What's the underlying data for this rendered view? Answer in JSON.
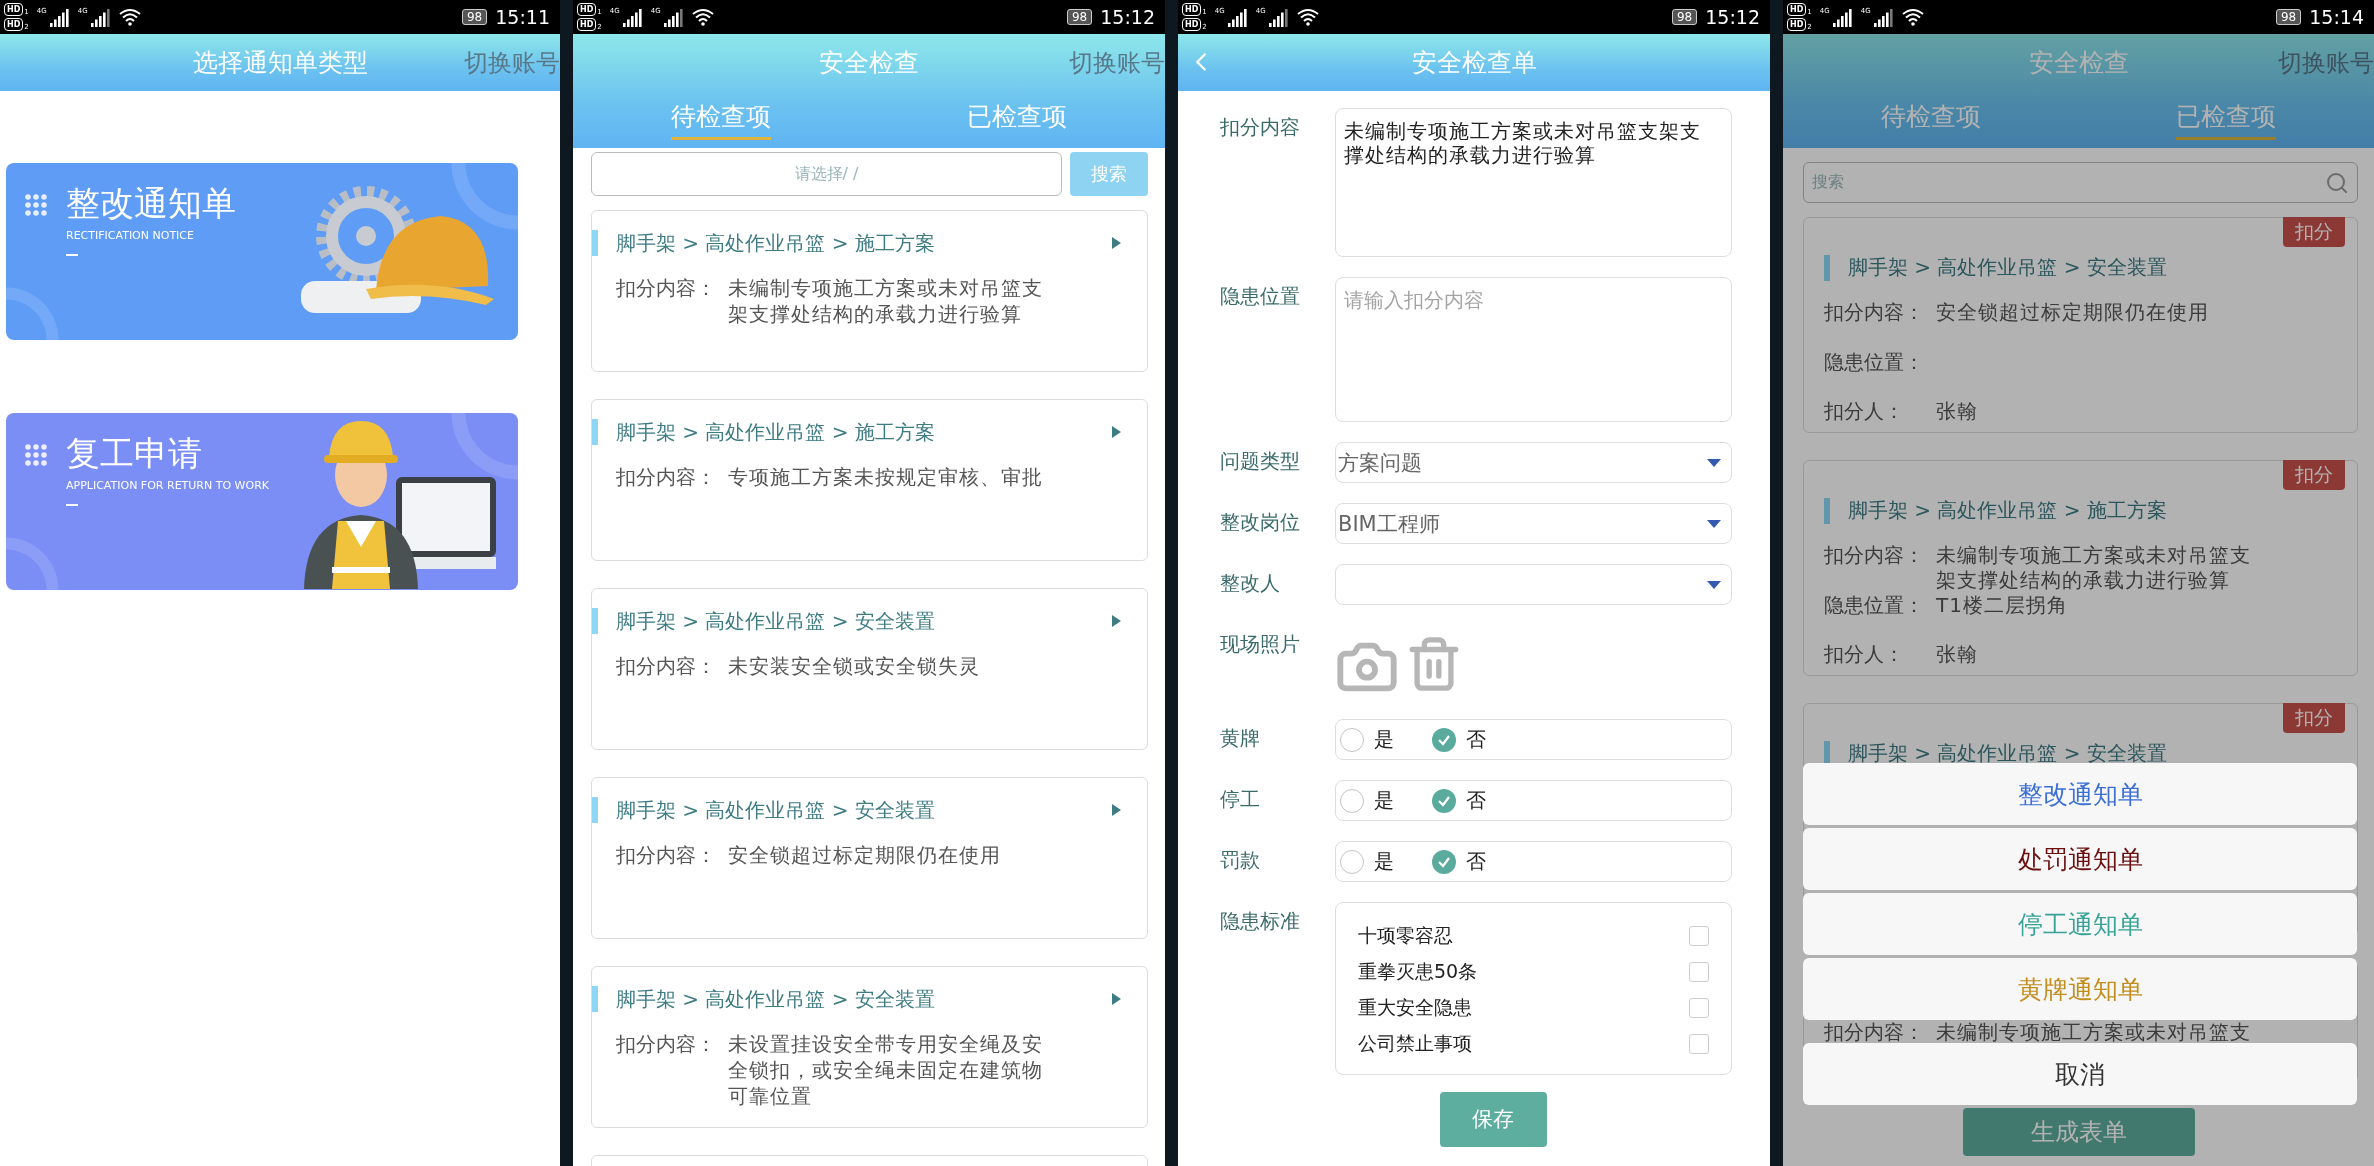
{
  "screens": [
    {
      "kind": "notice_types",
      "status_bar": {
        "sims": [
          {
            "label": "HD",
            "slot": "1"
          },
          {
            "label": "HD",
            "slot": "2"
          }
        ],
        "networks": [
          "4G",
          "4G"
        ],
        "battery": "98",
        "time": "15:11"
      },
      "title": "选择通知单类型",
      "header_action": "切换账号",
      "cards": [
        {
          "kind": "rectification",
          "title": "整改通知单",
          "subtitle": "RECTIFICATION NOTICE"
        },
        {
          "kind": "return_to_work",
          "title": "复工申请",
          "subtitle": "APPLICATION FOR RETURN TO WORK"
        }
      ]
    },
    {
      "kind": "inspection_list",
      "status_bar": {
        "sims": [
          {
            "label": "HD",
            "slot": "1"
          },
          {
            "label": "HD",
            "slot": "2"
          }
        ],
        "networks": [
          "4G",
          "4G"
        ],
        "battery": "98",
        "time": "15:12"
      },
      "title": "安全检查",
      "header_action": "切换账号",
      "tabs": [
        {
          "label": "待检查项",
          "selected": true
        },
        {
          "label": "已检查项",
          "selected": false
        }
      ],
      "search": {
        "placeholder": "请选择/ /",
        "button": "搜索"
      },
      "items": [
        {
          "path": "脚手架 > 高处作业吊篮 > 施工方案",
          "label": "扣分内容：",
          "content": "未编制专项施工方案或未对吊篮支架支撑处结构的承载力进行验算"
        },
        {
          "path": "脚手架 > 高处作业吊篮 > 施工方案",
          "label": "扣分内容：",
          "content": "专项施工方案未按规定审核、审批"
        },
        {
          "path": "脚手架 > 高处作业吊篮 > 安全装置",
          "label": "扣分内容：",
          "content": "未安装安全锁或安全锁失灵"
        },
        {
          "path": "脚手架 > 高处作业吊篮 > 安全装置",
          "label": "扣分内容：",
          "content": "安全锁超过标定期限仍在使用"
        },
        {
          "path": "脚手架 > 高处作业吊篮 > 安全装置",
          "label": "扣分内容：",
          "content": "未设置挂设安全带专用安全绳及安全锁扣，或安全绳未固定在建筑物可靠位置"
        }
      ]
    },
    {
      "kind": "inspection_form",
      "status_bar": {
        "sims": [
          {
            "label": "HD",
            "slot": "1"
          },
          {
            "label": "HD",
            "slot": "2"
          }
        ],
        "networks": [
          "4G",
          "4G"
        ],
        "battery": "98",
        "time": "15:12"
      },
      "title": "安全检查单",
      "fields": [
        {
          "kind": "textarea",
          "label": "扣分内容",
          "value": "未编制专项施工方案或未对吊篮支架支撑处结构的承载力进行验算"
        },
        {
          "kind": "textarea",
          "label": "隐患位置",
          "placeholder": "请输入扣分内容"
        },
        {
          "kind": "select",
          "label": "问题类型",
          "value": "方案问题"
        },
        {
          "kind": "select",
          "label": "整改岗位",
          "value": "BIM工程师"
        },
        {
          "kind": "select",
          "label": "整改人"
        },
        {
          "kind": "photos",
          "label": "现场照片"
        },
        {
          "kind": "radio",
          "label": "黄牌",
          "options": [
            {
              "label": "是",
              "selected": false
            },
            {
              "label": "否",
              "selected": true
            }
          ]
        },
        {
          "kind": "radio",
          "label": "停工",
          "options": [
            {
              "label": "是",
              "selected": false
            },
            {
              "label": "否",
              "selected": true
            }
          ]
        },
        {
          "kind": "radio",
          "label": "罚款",
          "options": [
            {
              "label": "是",
              "selected": false
            },
            {
              "label": "否",
              "selected": true
            }
          ]
        },
        {
          "kind": "checklist",
          "label": "隐患标准",
          "options": [
            {
              "label": "十项零容忍",
              "checked": false
            },
            {
              "label": "重拳灭患50条",
              "checked": false
            },
            {
              "label": "重大安全隐患",
              "checked": false
            },
            {
              "label": "公司禁止事项",
              "checked": false
            }
          ]
        }
      ],
      "save": "保存"
    },
    {
      "kind": "checked_list",
      "status_bar": {
        "sims": [
          {
            "label": "HD",
            "slot": "1"
          },
          {
            "label": "HD",
            "slot": "2"
          }
        ],
        "networks": [
          "4G",
          "4G"
        ],
        "battery": "98",
        "time": "15:14"
      },
      "title": "安全检查",
      "header_action": "切换账号",
      "tabs": [
        {
          "label": "待检查项",
          "selected": false
        },
        {
          "label": "已检查项",
          "selected": true
        }
      ],
      "search": {
        "placeholder": "搜索"
      },
      "items": [
        {
          "badge": "扣分",
          "path": "脚手架 > 高处作业吊篮 > 安全装置",
          "fields": [
            {
              "label": "扣分内容：",
              "value": "安全锁超过标定期限仍在使用"
            },
            {
              "label": "隐患位置："
            },
            {
              "label": "扣分人：",
              "value": "张翰"
            }
          ]
        },
        {
          "badge": "扣分",
          "path": "脚手架 > 高处作业吊篮 > 施工方案",
          "fields": [
            {
              "label": "扣分内容：",
              "value": "未编制专项施工方案或未对吊篮支架支撑处结构的承载力进行验算"
            },
            {
              "label": "隐患位置：",
              "value": "T1楼二层拐角"
            },
            {
              "label": "扣分人：",
              "value": "张翰"
            }
          ]
        },
        {
          "badge": "扣分",
          "path": "脚手架 > 高处作业吊篮 > 安全装置"
        },
        {
          "fields": [
            {
              "label": "扣分内容：",
              "value": "未编制专项施工方案或未对吊篮支"
            }
          ]
        }
      ],
      "generate_button": "生成表单",
      "action_sheet": {
        "options": [
          {
            "label": "整改通知单",
            "color": "#3b6fd6"
          },
          {
            "label": "处罚通知单",
            "color": "#6b1010"
          },
          {
            "label": "停工通知单",
            "color": "#3aa397"
          },
          {
            "label": "黄牌通知单",
            "color": "#c38d1c"
          }
        ],
        "cancel": "取消"
      }
    }
  ]
}
